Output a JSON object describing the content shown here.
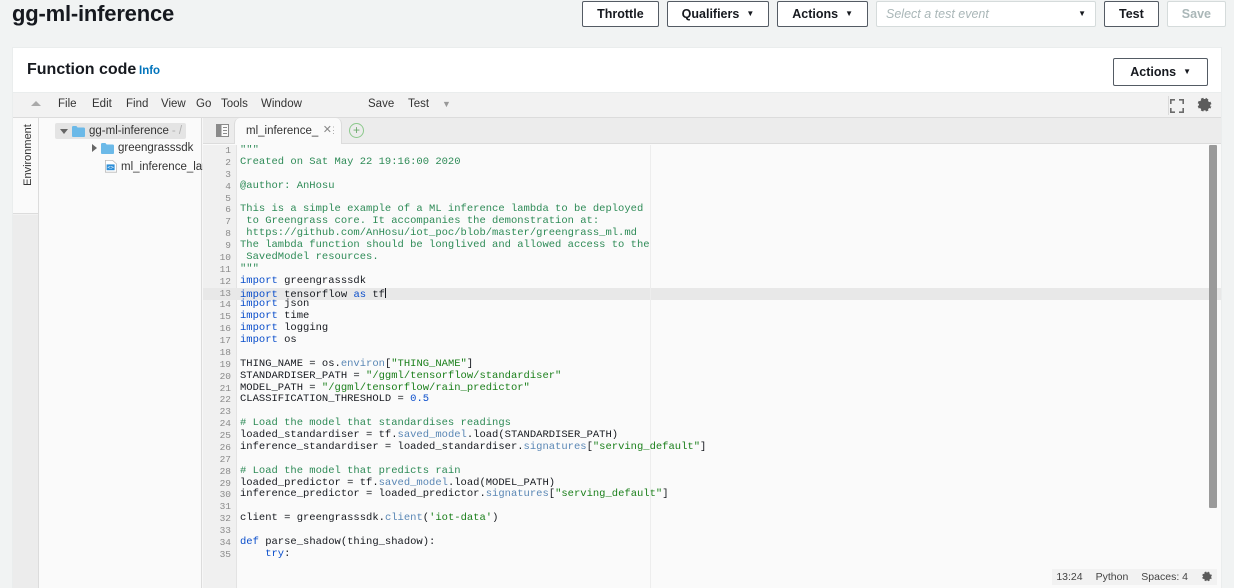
{
  "header": {
    "function_name": "gg-ml-inference",
    "buttons": [
      {
        "label": "Throttle",
        "caret": false,
        "disabled": false
      },
      {
        "label": "Qualifiers",
        "caret": true,
        "disabled": false
      },
      {
        "label": "Actions",
        "caret": true,
        "disabled": false
      }
    ],
    "test_event": {
      "placeholder": "Select a test event",
      "value": ""
    },
    "test_label": "Test",
    "save_label": "Save"
  },
  "panel": {
    "title": "Function code",
    "info_link": "Info",
    "actions_label": "Actions"
  },
  "c9": {
    "menu": [
      "File",
      "Edit",
      "Find",
      "View",
      "Go",
      "Tools",
      "Window"
    ],
    "menu_right": [
      "Save",
      "Test"
    ],
    "env_label": "Environment",
    "tree": {
      "root": {
        "label": "gg-ml-inference",
        "path": "- /"
      },
      "children": [
        {
          "label": "greengrasssdk",
          "type": "folder"
        },
        {
          "label": "ml_inference_lambda.py",
          "type": "file"
        }
      ]
    },
    "tab": {
      "name": "ml_inference_lambda.py",
      "display": "ml_inference_lar"
    },
    "status": {
      "cursor": "13:24",
      "language": "Python",
      "indent": "Spaces: 4"
    }
  },
  "code": {
    "lines": [
      {
        "n": 1,
        "tokens": [
          {
            "t": "\"\"\"",
            "c": "cm"
          }
        ]
      },
      {
        "n": 2,
        "tokens": [
          {
            "t": "Created on Sat May 22 19:16:00 2020",
            "c": "cm"
          }
        ]
      },
      {
        "n": 3,
        "tokens": []
      },
      {
        "n": 4,
        "tokens": [
          {
            "t": "@author: AnHosu",
            "c": "cm"
          }
        ]
      },
      {
        "n": 5,
        "tokens": []
      },
      {
        "n": 6,
        "tokens": [
          {
            "t": "This is a simple example of a ML inference lambda to be deployed",
            "c": "cm"
          }
        ]
      },
      {
        "n": 7,
        "tokens": [
          {
            "t": " to Greengrass core. It accompanies the demonstration at:",
            "c": "cm"
          }
        ]
      },
      {
        "n": 8,
        "tokens": [
          {
            "t": " https://github.com/AnHosu/iot_poc/blob/master/greengrass_ml.md",
            "c": "cm"
          }
        ]
      },
      {
        "n": 9,
        "tokens": [
          {
            "t": "The lambda function should be longlived and allowed access to the",
            "c": "cm"
          }
        ]
      },
      {
        "n": 10,
        "tokens": [
          {
            "t": " SavedModel resources.",
            "c": "cm"
          }
        ]
      },
      {
        "n": 11,
        "tokens": [
          {
            "t": "\"\"\"",
            "c": "cm"
          }
        ]
      },
      {
        "n": 12,
        "tokens": [
          {
            "t": "import",
            "c": "k"
          },
          {
            "t": " greengrasssdk",
            "c": ""
          }
        ]
      },
      {
        "n": 13,
        "tokens": [
          {
            "t": "import",
            "c": "k"
          },
          {
            "t": " tensorflow ",
            "c": ""
          },
          {
            "t": "as",
            "c": "k"
          },
          {
            "t": " tf",
            "c": ""
          },
          {
            "t": "",
            "c": "cursor"
          }
        ],
        "active": true
      },
      {
        "n": 14,
        "tokens": [
          {
            "t": "import",
            "c": "k"
          },
          {
            "t": " json",
            "c": ""
          }
        ]
      },
      {
        "n": 15,
        "tokens": [
          {
            "t": "import",
            "c": "k"
          },
          {
            "t": " time",
            "c": ""
          }
        ]
      },
      {
        "n": 16,
        "tokens": [
          {
            "t": "import",
            "c": "k"
          },
          {
            "t": " logging",
            "c": ""
          }
        ]
      },
      {
        "n": 17,
        "tokens": [
          {
            "t": "import",
            "c": "k"
          },
          {
            "t": " os",
            "c": ""
          }
        ]
      },
      {
        "n": 18,
        "tokens": []
      },
      {
        "n": 19,
        "tokens": [
          {
            "t": "THING_NAME = os.",
            "c": ""
          },
          {
            "t": "environ",
            "c": "fn"
          },
          {
            "t": "[",
            "c": ""
          },
          {
            "t": "\"THING_NAME\"",
            "c": "st"
          },
          {
            "t": "]",
            "c": ""
          }
        ]
      },
      {
        "n": 20,
        "tokens": [
          {
            "t": "STANDARDISER_PATH = ",
            "c": ""
          },
          {
            "t": "\"/ggml/tensorflow/standardiser\"",
            "c": "st"
          }
        ]
      },
      {
        "n": 21,
        "tokens": [
          {
            "t": "MODEL_PATH = ",
            "c": ""
          },
          {
            "t": "\"/ggml/tensorflow/rain_predictor\"",
            "c": "st"
          }
        ]
      },
      {
        "n": 22,
        "tokens": [
          {
            "t": "CLASSIFICATION_THRESHOLD = ",
            "c": ""
          },
          {
            "t": "0.5",
            "c": "num"
          }
        ]
      },
      {
        "n": 23,
        "tokens": []
      },
      {
        "n": 24,
        "tokens": [
          {
            "t": "# Load the model that standardises readings",
            "c": "cm"
          }
        ]
      },
      {
        "n": 25,
        "tokens": [
          {
            "t": "loaded_standardiser = tf.",
            "c": ""
          },
          {
            "t": "saved_model",
            "c": "fn"
          },
          {
            "t": ".load(STANDARDISER_PATH)",
            "c": ""
          }
        ]
      },
      {
        "n": 26,
        "tokens": [
          {
            "t": "inference_standardiser = loaded_standardiser.",
            "c": ""
          },
          {
            "t": "signatures",
            "c": "fn"
          },
          {
            "t": "[",
            "c": ""
          },
          {
            "t": "\"serving_default\"",
            "c": "st"
          },
          {
            "t": "]",
            "c": ""
          }
        ]
      },
      {
        "n": 27,
        "tokens": []
      },
      {
        "n": 28,
        "tokens": [
          {
            "t": "# Load the model that predicts rain",
            "c": "cm"
          }
        ]
      },
      {
        "n": 29,
        "tokens": [
          {
            "t": "loaded_predictor = tf.",
            "c": ""
          },
          {
            "t": "saved_model",
            "c": "fn"
          },
          {
            "t": ".load(MODEL_PATH)",
            "c": ""
          }
        ]
      },
      {
        "n": 30,
        "tokens": [
          {
            "t": "inference_predictor = loaded_predictor.",
            "c": ""
          },
          {
            "t": "signatures",
            "c": "fn"
          },
          {
            "t": "[",
            "c": ""
          },
          {
            "t": "\"serving_default\"",
            "c": "st"
          },
          {
            "t": "]",
            "c": ""
          }
        ]
      },
      {
        "n": 31,
        "tokens": []
      },
      {
        "n": 32,
        "tokens": [
          {
            "t": "client = greengrasssdk.",
            "c": ""
          },
          {
            "t": "client",
            "c": "fn"
          },
          {
            "t": "(",
            "c": ""
          },
          {
            "t": "'iot-data'",
            "c": "st"
          },
          {
            "t": ")",
            "c": ""
          }
        ]
      },
      {
        "n": 33,
        "tokens": []
      },
      {
        "n": 34,
        "tokens": [
          {
            "t": "def",
            "c": "k"
          },
          {
            "t": " parse_shadow(thing_shadow):",
            "c": ""
          }
        ]
      },
      {
        "n": 35,
        "tokens": [
          {
            "t": "    try",
            "c": "k"
          },
          {
            "t": ":",
            "c": ""
          }
        ]
      }
    ]
  },
  "colors": {
    "accent_link": "#0073bb",
    "page_bg": "#f1f3f3",
    "comment_green": "#2e8b57",
    "keyword_blue": "#0a4ecb",
    "string_green": "#1a7f1a"
  }
}
